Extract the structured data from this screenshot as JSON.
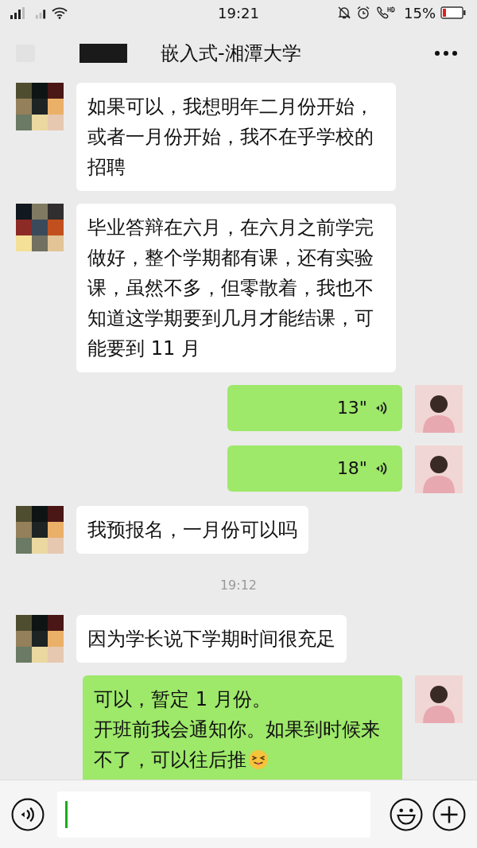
{
  "status_bar": {
    "time": "19:21",
    "battery": "15%"
  },
  "header": {
    "title": "嵌入式-湘潭大学"
  },
  "messages": [
    {
      "kind": "text",
      "outgoing": false,
      "text": "如果可以，我想明年二月份开始，或者一月份开始，我不在乎学校的招聘"
    },
    {
      "kind": "text",
      "outgoing": false,
      "text": "毕业答辩在六月，在六月之前学完做好，整个学期都有课，还有实验课，虽然不多，但零散着，我也不知道这学期要到几月才能结课，可能要到 11 月"
    },
    {
      "kind": "voice",
      "outgoing": true,
      "text": "13\""
    },
    {
      "kind": "voice",
      "outgoing": true,
      "text": "18\""
    },
    {
      "kind": "text",
      "outgoing": false,
      "text": "我预报名，一月份可以吗"
    },
    {
      "kind": "time",
      "text": "19:12"
    },
    {
      "kind": "text",
      "outgoing": false,
      "text": "因为学长说下学期时间很充足"
    },
    {
      "kind": "text",
      "outgoing": true,
      "lines": [
        "可以，暂定 1 月份。",
        "开班前我会通知你。如果到时候来不了，可以往后推"
      ],
      "emoji": true
    }
  ]
}
